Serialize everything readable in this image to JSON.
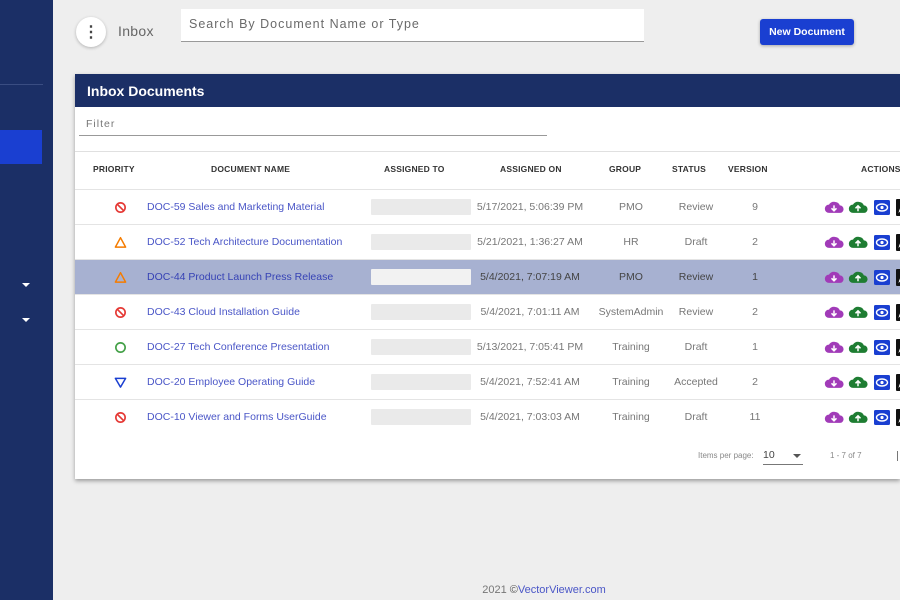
{
  "colors": {
    "brand": "#1b2f66",
    "accent": "#1a3fd1",
    "selected_row": "#a7b1d1",
    "link": "#4a56c7"
  },
  "header": {
    "menu_icon": "more-vert-icon",
    "menu_glyph": "⋮",
    "title": "Inbox",
    "search_placeholder": "Search By Document Name or Type",
    "new_button": "New Document"
  },
  "card": {
    "title": "Inbox Documents",
    "filter_placeholder": "Filter"
  },
  "table": {
    "columns": {
      "priority": "PRIORITY",
      "document_name": "DOCUMENT NAME",
      "assigned_to": "ASSIGNED TO",
      "assigned_on": "ASSIGNED ON",
      "group": "GROUP",
      "status": "STATUS",
      "version": "VERSION",
      "actions": "ACTIONS"
    },
    "rows": [
      {
        "priority": "high",
        "name": "DOC-59 Sales and Marketing Material",
        "assigned_on": "5/17/2021, 5:06:39 PM",
        "group": "PMO",
        "status": "Review",
        "version": "9",
        "selected": false
      },
      {
        "priority": "medium",
        "name": "DOC-52 Tech Architecture Documentation",
        "assigned_on": "5/21/2021, 1:36:27 AM",
        "group": "HR",
        "status": "Draft",
        "version": "2",
        "selected": false
      },
      {
        "priority": "medium",
        "name": "DOC-44 Product Launch Press Release",
        "assigned_on": "5/4/2021, 7:07:19 AM",
        "group": "PMO",
        "status": "Review",
        "version": "1",
        "selected": true
      },
      {
        "priority": "high",
        "name": "DOC-43 Cloud Installation Guide",
        "assigned_on": "5/4/2021, 7:01:11 AM",
        "group": "SystemAdmin",
        "status": "Review",
        "version": "2",
        "selected": false
      },
      {
        "priority": "normal",
        "name": "DOC-27 Tech Conference Presentation",
        "assigned_on": "5/13/2021, 7:05:41 PM",
        "group": "Training",
        "status": "Draft",
        "version": "1",
        "selected": false
      },
      {
        "priority": "low",
        "name": "DOC-20 Employee Operating Guide",
        "assigned_on": "5/4/2021, 7:52:41 AM",
        "group": "Training",
        "status": "Accepted",
        "version": "2",
        "selected": false
      },
      {
        "priority": "high",
        "name": "DOC-10 Viewer and Forms UserGuide",
        "assigned_on": "5/4/2021, 7:03:03 AM",
        "group": "Training",
        "status": "Draft",
        "version": "11",
        "selected": false
      }
    ],
    "action_icons": [
      "cloud-download-icon",
      "cloud-upload-icon",
      "view-icon",
      "edit-icon"
    ],
    "priority_icons": {
      "high": "no-entry-icon",
      "medium": "triangle-warning-icon",
      "normal": "circle-icon",
      "low": "triangle-down-icon"
    },
    "priority_colors": {
      "high": "#e53935",
      "medium": "#f57c00",
      "normal": "#43a047",
      "low": "#1a3fd1"
    }
  },
  "pagination": {
    "label": "Items per page:",
    "per_page": "10",
    "range": "1 - 7 of 7"
  },
  "footer": {
    "year": "2021",
    "symbol": "©",
    "brand": "VectorViewer.com"
  }
}
